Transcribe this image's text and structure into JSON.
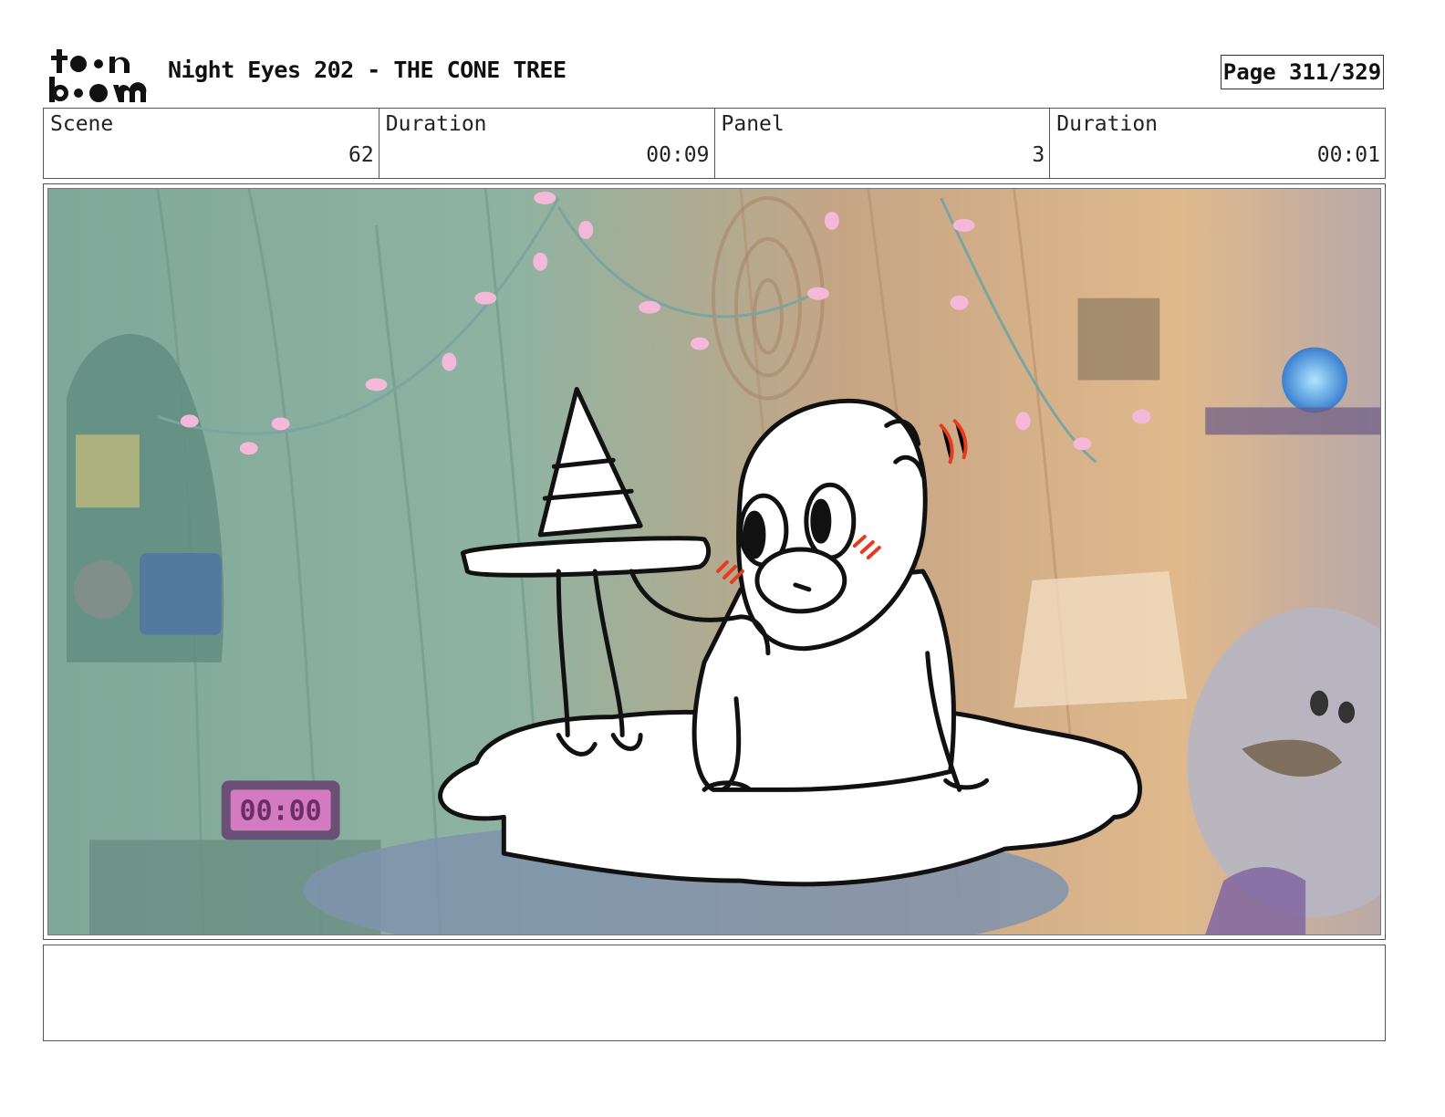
{
  "header": {
    "logo_top": "to•n",
    "logo_bottom": "b••m",
    "title": "Night Eyes 202 - THE CONE TREE",
    "page": "Page 311/329"
  },
  "info": {
    "scene_label": "Scene",
    "scene_value": "62",
    "duration_label": "Duration",
    "duration_value": "00:09",
    "panel_label": "Panel",
    "panel_value": "3",
    "panel_duration_label": "Duration",
    "panel_duration_value": "00:01"
  },
  "panel": {
    "clock_text": "00:00",
    "note_text": "..."
  },
  "notes": {
    "text": ""
  }
}
